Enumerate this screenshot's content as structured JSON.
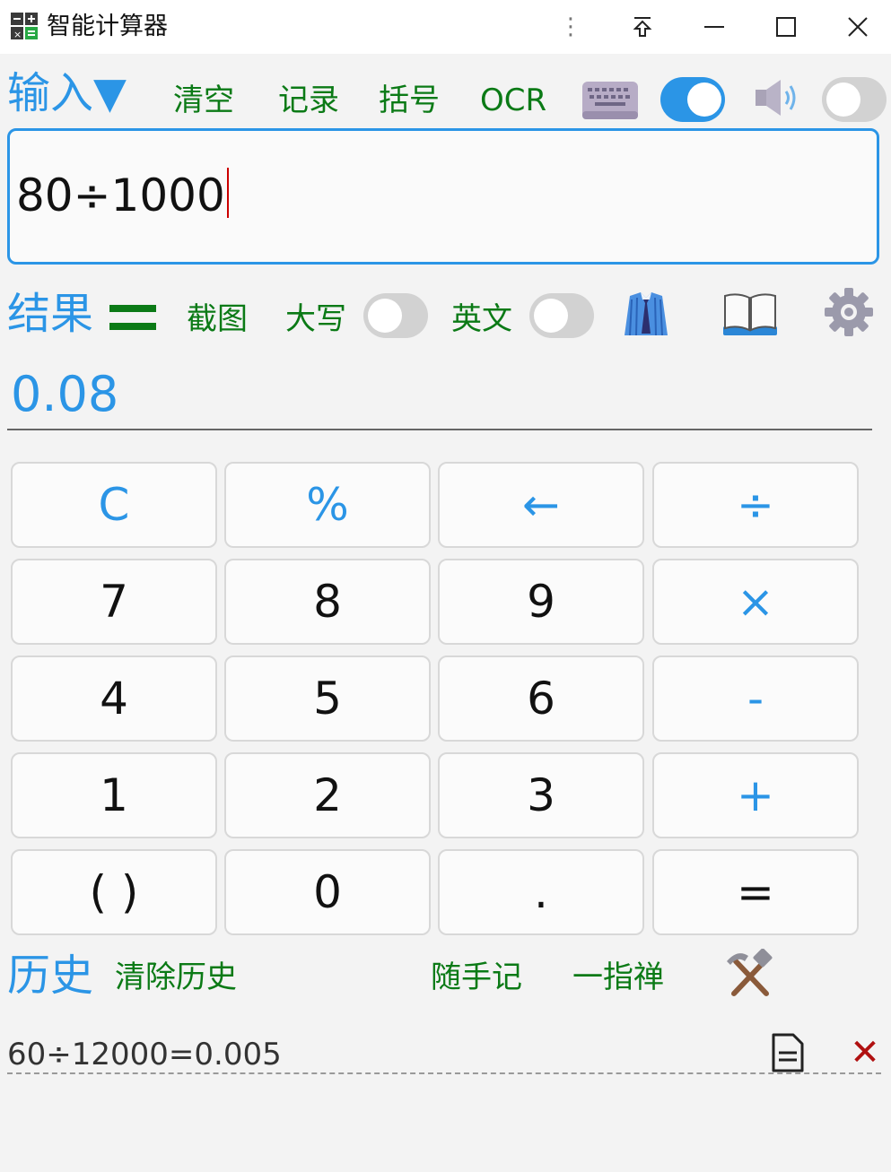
{
  "window": {
    "title": "智能计算器"
  },
  "toolbar": {
    "input_label": "输入▼",
    "clear": "清空",
    "record": "记录",
    "bracket": "括号",
    "ocr": "OCR",
    "keyboard_toggle_on": true,
    "voice_toggle_on": false
  },
  "expression": {
    "value": "80÷1000"
  },
  "result_bar": {
    "label": "结果",
    "screenshot": "截图",
    "uppercase": "大写",
    "uppercase_on": false,
    "english": "英文",
    "english_on": false
  },
  "result": {
    "value": "0.08"
  },
  "keypad": {
    "rows": [
      [
        {
          "label": "C",
          "type": "op"
        },
        {
          "label": "%",
          "type": "op"
        },
        {
          "label": "←",
          "type": "op"
        },
        {
          "label": "÷",
          "type": "op"
        }
      ],
      [
        {
          "label": "7",
          "type": "num"
        },
        {
          "label": "8",
          "type": "num"
        },
        {
          "label": "9",
          "type": "num"
        },
        {
          "label": "×",
          "type": "op"
        }
      ],
      [
        {
          "label": "4",
          "type": "num"
        },
        {
          "label": "5",
          "type": "num"
        },
        {
          "label": "6",
          "type": "num"
        },
        {
          "label": "-",
          "type": "op"
        }
      ],
      [
        {
          "label": "1",
          "type": "num"
        },
        {
          "label": "2",
          "type": "num"
        },
        {
          "label": "3",
          "type": "num"
        },
        {
          "label": "+",
          "type": "op"
        }
      ],
      [
        {
          "label": "( )",
          "type": "num"
        },
        {
          "label": "0",
          "type": "num"
        },
        {
          "label": ".",
          "type": "num"
        },
        {
          "label": "=",
          "type": "num"
        }
      ]
    ]
  },
  "history": {
    "label": "历史",
    "clear_history": "清除历史",
    "memo": "随手记",
    "zen": "一指禅",
    "entries": [
      "60÷12000=0.005"
    ]
  },
  "colors": {
    "accent": "#2b95e6",
    "link_green": "#0b7a16",
    "delete_red": "#b01010"
  }
}
